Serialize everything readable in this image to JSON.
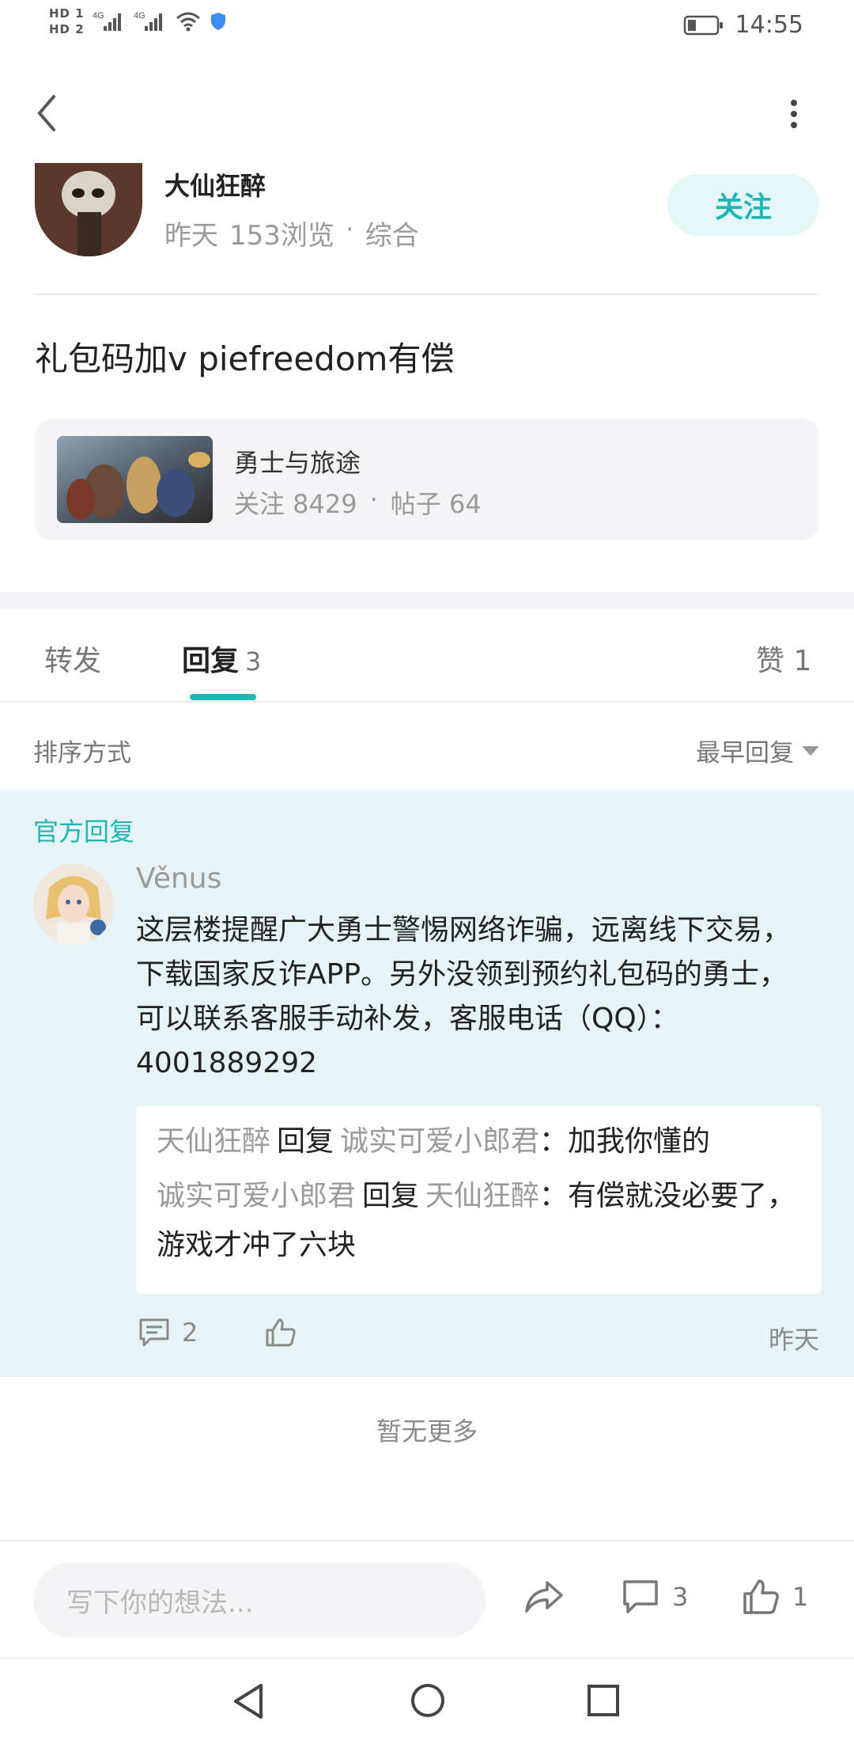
{
  "status_bar": {
    "hd1": "HD 1",
    "hd2": "HD 2",
    "net1": "4G",
    "net2": "4G",
    "time": "14:55"
  },
  "author": {
    "name": "大仙狂醉",
    "date": "昨天",
    "views": "153浏览",
    "dot": "·",
    "category": "综合",
    "follow_label": "关注"
  },
  "post": {
    "title": "礼包码加v piefreedom有偿"
  },
  "game": {
    "name": "勇士与旅途",
    "followers": "关注 8429",
    "dot": "·",
    "posts": "帖子 64"
  },
  "tabs": {
    "forward": "转发",
    "reply": "回复",
    "reply_count": "3",
    "like": "赞 1"
  },
  "sort": {
    "label": "排序方式",
    "selected": "最早回复"
  },
  "official_reply": {
    "label": "官方回复",
    "user": "Věnus",
    "text": "这层楼提醒广大勇士警惕网络诈骗，远离线下交易，下载国家反诈APP。另外没领到预约礼包码的勇士，可以联系客服手动补发，客服电话（QQ）：4001889292",
    "sub_replies": [
      {
        "from": "天仙狂醉",
        "verb": "回复",
        "to": "诚实可爱小郎君",
        "text": "：加我你懂的"
      },
      {
        "from": "诚实可爱小郎君",
        "verb": "回复",
        "to": "天仙狂醉",
        "text": "：有偿就没必要了，游戏才冲了六块"
      }
    ],
    "comment_count": "2",
    "time": "昨天"
  },
  "no_more": "暂无更多",
  "bottom_bar": {
    "input_placeholder": "写下你的想法...",
    "comment_count": "3",
    "like_count": "1"
  },
  "colors": {
    "accent": "#1fb7b6",
    "official_bg": "#e6f4f7",
    "follow_bg": "#e4f6f6"
  }
}
